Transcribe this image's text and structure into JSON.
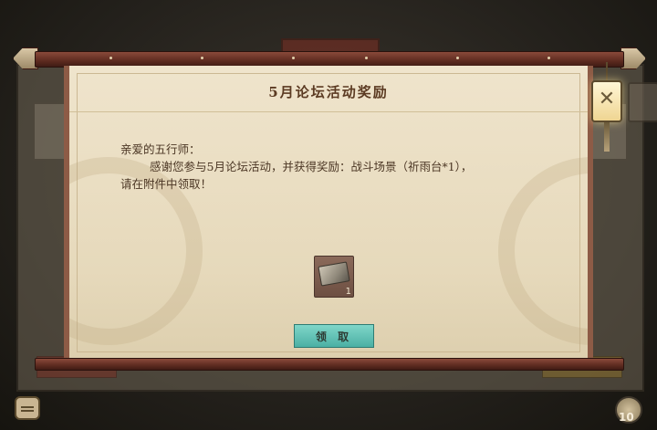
{
  "mail": {
    "title": "5月论坛活动奖励",
    "greeting": "亲爱的五行师：",
    "body_line1": "感谢您参与5月论坛活动，并获得奖励：战斗场景（祈雨台*1），",
    "body_line2": "请在附件中领取！",
    "attachment": {
      "quantity": "1",
      "icon": "scene-scroll-icon"
    },
    "claim_label": "领 取"
  },
  "hud": {
    "counter": "10"
  }
}
